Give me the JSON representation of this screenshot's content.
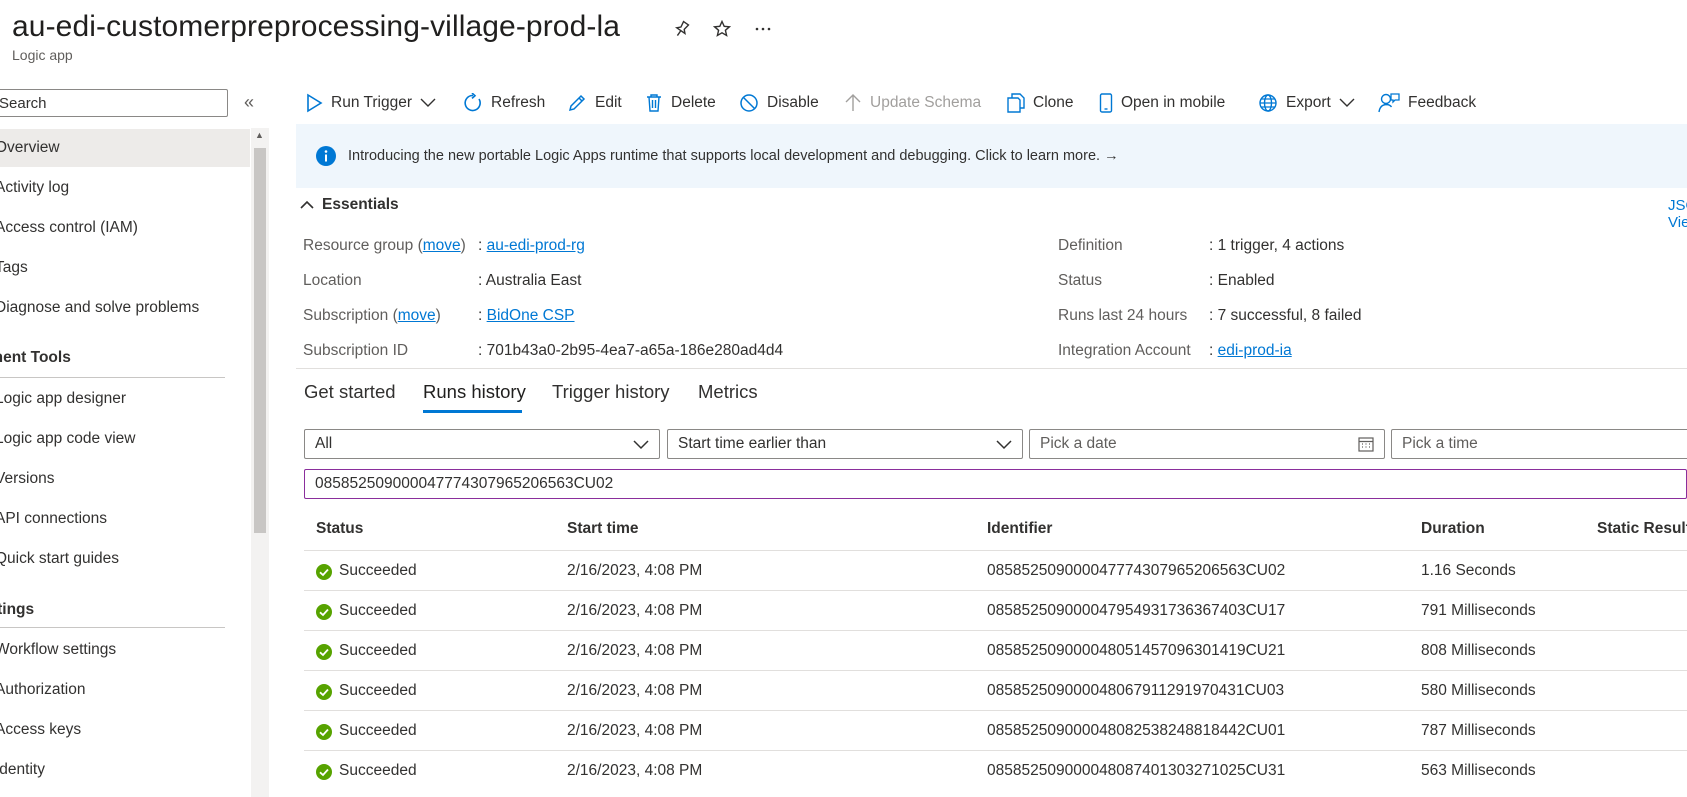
{
  "header": {
    "title": "au-edi-customerpreprocessing-village-prod-la",
    "subtitle": "Logic app"
  },
  "sidebar": {
    "search_placeholder": "Search",
    "items_top": [
      {
        "label": "Overview",
        "selected": true
      },
      {
        "label": "Activity log"
      },
      {
        "label": "Access control (IAM)"
      },
      {
        "label": "Tags"
      },
      {
        "label": "Diagnose and solve problems"
      }
    ],
    "section1": "Development Tools",
    "items_dev": [
      {
        "label": "Logic app designer"
      },
      {
        "label": "Logic app code view"
      },
      {
        "label": "Versions"
      },
      {
        "label": "API connections"
      },
      {
        "label": "Quick start guides"
      }
    ],
    "section2": "Settings",
    "items_settings": [
      {
        "label": "Workflow settings"
      },
      {
        "label": "Authorization"
      },
      {
        "label": "Access keys"
      },
      {
        "label": "Identity"
      }
    ]
  },
  "toolbar": {
    "run_trigger": "Run Trigger",
    "refresh": "Refresh",
    "edit": "Edit",
    "delete": "Delete",
    "disable": "Disable",
    "update_schema": "Update Schema",
    "clone": "Clone",
    "open_in_mobile": "Open in mobile",
    "export": "Export",
    "feedback": "Feedback"
  },
  "banner": {
    "text": "Introducing the new portable Logic Apps runtime that supports local development and debugging. Click to learn more. →"
  },
  "essentials": {
    "heading": "Essentials",
    "json_view": "JSON View",
    "move": "move",
    "left": [
      {
        "key": "Resource group",
        "value": "au-edi-prod-rg"
      },
      {
        "key": "Location",
        "value": "Australia East"
      },
      {
        "key": "Subscription",
        "value": "BidOne CSP"
      },
      {
        "key": "Subscription ID",
        "value": "701b43a0-2b95-4ea7-a65a-186e280ad4d4"
      }
    ],
    "right": [
      {
        "key": "Definition",
        "value": "1 trigger, 4 actions"
      },
      {
        "key": "Status",
        "value": "Enabled"
      },
      {
        "key": "Runs last 24 hours",
        "value": "7 successful, 8 failed"
      },
      {
        "key": "Integration Account",
        "value": "edi-prod-ia"
      }
    ]
  },
  "tabs": [
    "Get started",
    "Runs history",
    "Trigger history",
    "Metrics"
  ],
  "filters": {
    "status": "All",
    "time_filter": "Start time earlier than",
    "date_placeholder": "Pick a date",
    "time_placeholder": "Pick a time",
    "identifier_value": "08585250900004777430796520656​3CU02"
  },
  "table": {
    "columns": [
      "Status",
      "Start time",
      "Identifier",
      "Duration",
      "Static Results"
    ],
    "rows": [
      {
        "status": "Succeeded",
        "start": "2/16/2023, 4:08 PM",
        "id": "08585250900004777430796520656​3CU02",
        "duration": "1.16 Seconds"
      },
      {
        "status": "Succeeded",
        "start": "2/16/2023, 4:08 PM",
        "id": "08585250900004795493173636740​3CU17",
        "duration": "791 Milliseconds"
      },
      {
        "status": "Succeeded",
        "start": "2/16/2023, 4:08 PM",
        "id": "08585250900004805145709630141​9CU21",
        "duration": "808 Milliseconds"
      },
      {
        "status": "Succeeded",
        "start": "2/16/2023, 4:08 PM",
        "id": "08585250900004806791129197043​1CU03",
        "duration": "580 Milliseconds"
      },
      {
        "status": "Succeeded",
        "start": "2/16/2023, 4:08 PM",
        "id": "08585250900004808253824881844​2CU01",
        "duration": "787 Milliseconds"
      },
      {
        "status": "Succeeded",
        "start": "2/16/2023, 4:08 PM",
        "id": "08585250900004808740130327102​5CU31",
        "duration": "563 Milliseconds"
      }
    ]
  },
  "colors": {
    "accent": "#0078d4",
    "success": "#57a300",
    "banner_bg": "#eff6fc"
  }
}
